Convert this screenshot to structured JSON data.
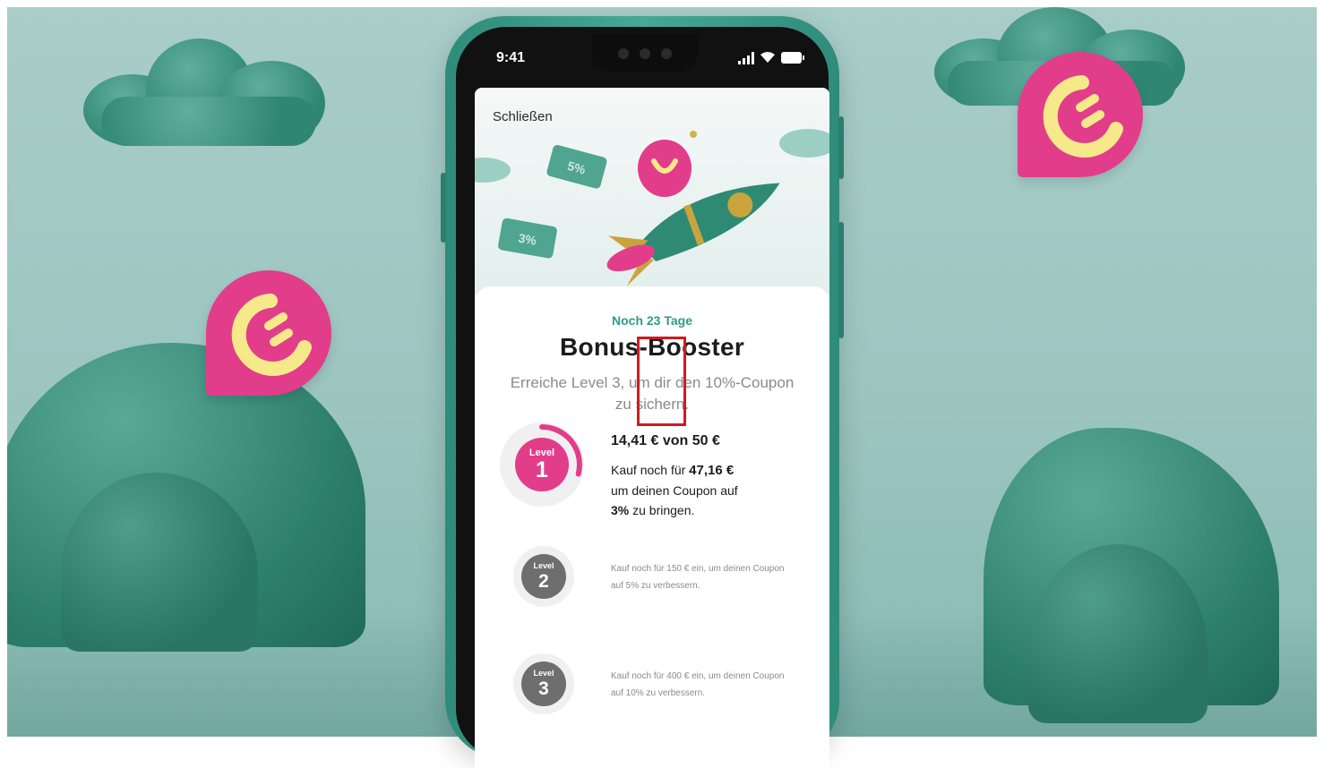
{
  "status_bar": {
    "time": "9:41"
  },
  "screen": {
    "close_label": "Schließen",
    "tickets": [
      "5%",
      "3%"
    ],
    "days_left": "Noch 23 Tage",
    "title": "Bonus-Booster",
    "subtitle": "Erreiche Level 3, um dir den 10%-Coupon zu sichern.",
    "levels": [
      {
        "label": "Level",
        "number": "1",
        "amount": "14,41 €",
        "amount_suffix": "von 50 €",
        "detail_pre": "Kauf noch für",
        "detail_value": "47,16 €",
        "detail_mid": "um deinen Coupon auf",
        "detail_pct": "3%",
        "detail_post": "zu bringen.",
        "progress": 0.29
      },
      {
        "label": "Level",
        "number": "2",
        "detail": "Kauf noch für 150 € ein, um deinen Coupon auf 5% zu verbessern."
      },
      {
        "label": "Level",
        "number": "3",
        "detail": "Kauf noch für 400 € ein, um deinen Coupon auf 10% zu verbessern."
      }
    ]
  },
  "colors": {
    "accent_green": "#2f9b86",
    "brand_pink": "#e23d8a",
    "brand_yellow": "#f6e98a",
    "phone_green": "#3a9c89",
    "highlight_box": "#d11a22"
  }
}
